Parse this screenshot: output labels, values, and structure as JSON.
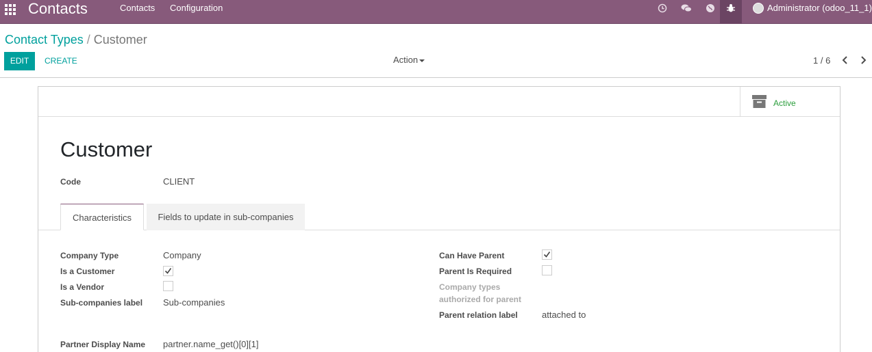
{
  "navbar": {
    "app_name": "Contacts",
    "menu": [
      "Contacts",
      "Configuration"
    ],
    "user": "Administrator (odoo_11_1)",
    "icons": [
      "apps-icon",
      "clock-icon",
      "chat-icon",
      "globe-icon",
      "bug-icon"
    ],
    "color": "#875a7b"
  },
  "breadcrumb": {
    "parent": "Contact Types",
    "separator": "/",
    "current": "Customer"
  },
  "control_panel": {
    "edit_label": "EDIT",
    "create_label": "CREATE",
    "action_label": "Action",
    "pager": "1 / 6"
  },
  "sheet": {
    "active_label": "Active",
    "title": "Customer",
    "code_label": "Code",
    "code_value": "CLIENT"
  },
  "tabs": [
    "Characteristics",
    "Fields to update in sub-companies"
  ],
  "left_fields": {
    "company_type": {
      "label": "Company Type",
      "value": "Company"
    },
    "is_customer": {
      "label": "Is a Customer",
      "checked": true
    },
    "is_vendor": {
      "label": "Is a Vendor",
      "checked": false
    },
    "subcompanies_label": {
      "label": "Sub-companies label",
      "value": "Sub-companies"
    },
    "partner_display_name": {
      "label": "Partner Display Name",
      "value": "partner.name_get()[0][1]"
    }
  },
  "right_fields": {
    "can_have_parent": {
      "label": "Can Have Parent",
      "checked": true
    },
    "parent_required": {
      "label": "Parent Is Required",
      "checked": false
    },
    "authorized_types": {
      "label_line1": "Company types",
      "label_line2": "authorized for parent"
    },
    "parent_relation_label": {
      "label": "Parent relation label",
      "value": "attached to"
    }
  },
  "colors": {
    "brand": "#875a7b",
    "primary": "#00a09d",
    "active": "#2a9d3b"
  }
}
